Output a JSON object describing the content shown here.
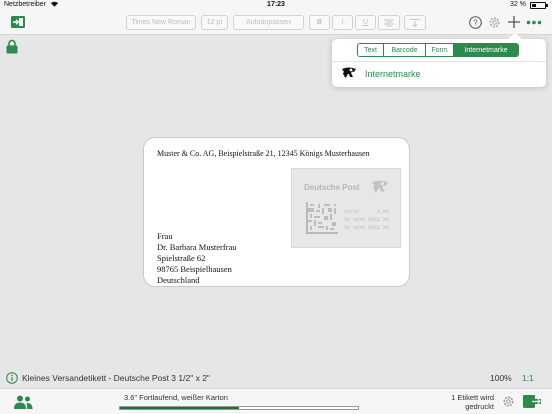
{
  "status_bar": {
    "carrier": "Netzbetreiber",
    "time": "17:23",
    "battery": "32 %",
    "battery_level": 0.32
  },
  "toolbar": {
    "font_name": "Times New Roman",
    "font_size": "12 pt",
    "fit_label": "Autoanpassen",
    "bold": "B",
    "italic": "I",
    "underline": "U"
  },
  "popover": {
    "tabs": [
      {
        "label": "Text",
        "active": false
      },
      {
        "label": "Barcode",
        "active": false
      },
      {
        "label": "Form",
        "active": false
      },
      {
        "label": "Internetmarke",
        "active": true
      }
    ],
    "item_label": "Internetmarke"
  },
  "label": {
    "sender": "Muster & Co. AG, Beispielstraße 21, 12345 Königs Musterhausen",
    "recipient": [
      "Frau",
      "Dr. Barbara Musterfrau",
      "Spielstraße 62",
      "98765 Beispielhausen",
      "Deutschland"
    ],
    "stamp": {
      "brand": "Deutsche Post",
      "code_lines": [
        "XX/XX      X,XX",
        "XX XXXX XXXX XX",
        "XX XXXX XXXX XX"
      ]
    }
  },
  "info_bar": {
    "label_type": "Kleines Versandetikett - Deutsche Post 3 1/2\" x 2\"",
    "zoom": "100%",
    "ratio": "1:1"
  },
  "bottom_bar": {
    "media": "3.6\" Fortlaufend, weißer Karton",
    "media_progress": 0.5,
    "print_count": "1 Etikett wird gedruckt"
  },
  "colors": {
    "accent": "#2c8a4c",
    "dark_green": "#1f6b3a"
  }
}
